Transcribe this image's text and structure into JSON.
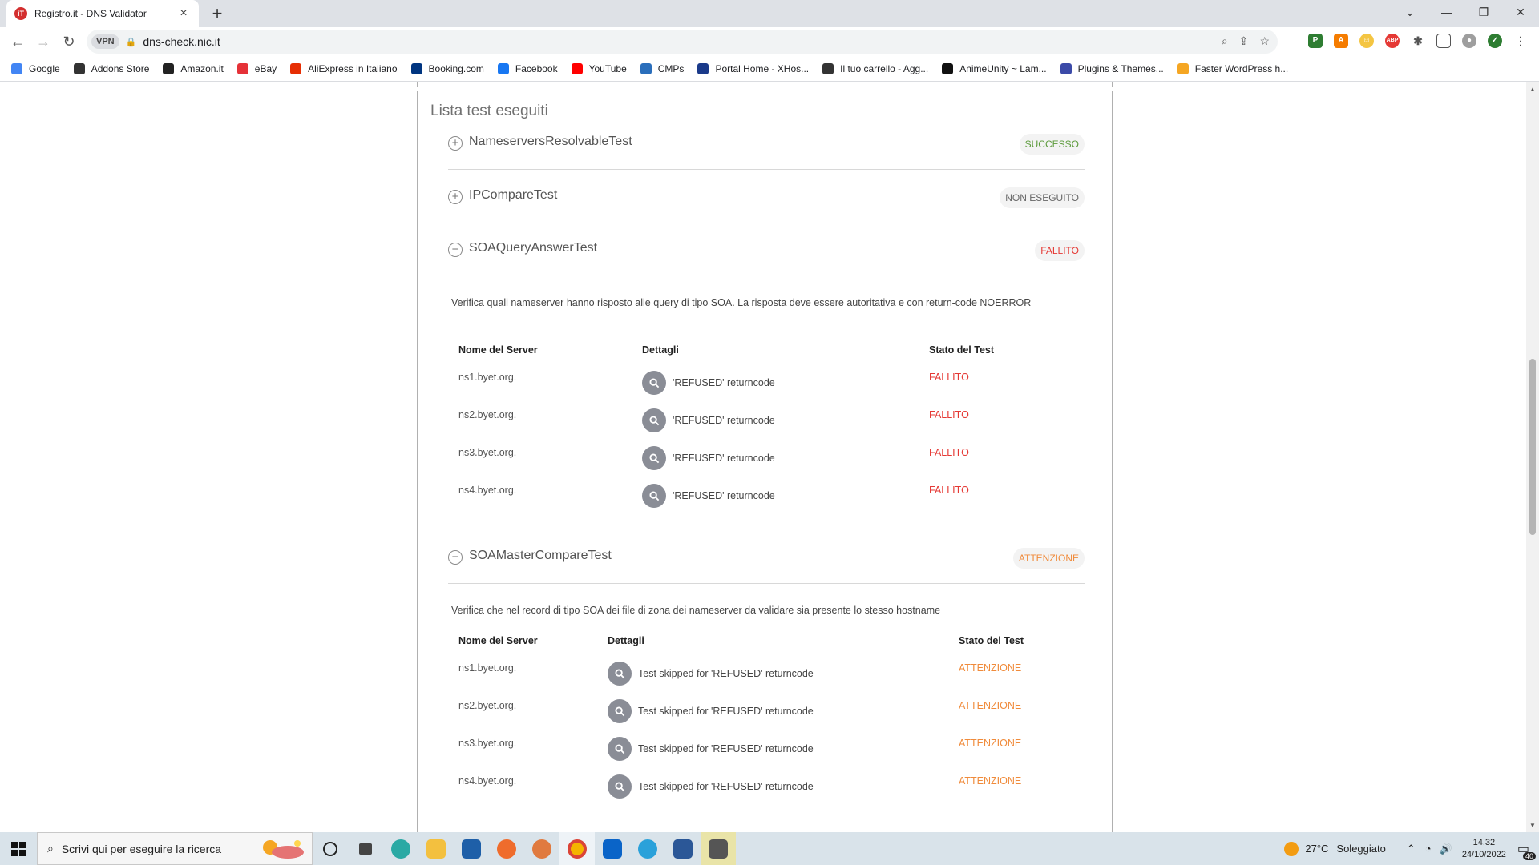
{
  "browser": {
    "tab_title": "Registro.it - DNS Validator",
    "favicon_text": "iT",
    "close_glyph": "×",
    "new_tab_glyph": "+",
    "url": "dns-check.nic.it",
    "vpn_label": "VPN"
  },
  "bookmarks": [
    {
      "label": "Google",
      "icon": "google-icon",
      "color": "#4285f4"
    },
    {
      "label": "Addons Store",
      "icon": "addons-store-icon",
      "color": "#333333"
    },
    {
      "label": "Amazon.it",
      "icon": "amazon-icon",
      "color": "#222222"
    },
    {
      "label": "eBay",
      "icon": "ebay-icon",
      "color": "#e53238"
    },
    {
      "label": "AliExpress in Italiano",
      "icon": "aliexpress-icon",
      "color": "#e62e04"
    },
    {
      "label": "Booking.com",
      "icon": "booking-icon",
      "color": "#003580"
    },
    {
      "label": "Facebook",
      "icon": "facebook-icon",
      "color": "#1877f2"
    },
    {
      "label": "YouTube",
      "icon": "youtube-icon",
      "color": "#ff0000"
    },
    {
      "label": "CMPs",
      "icon": "cmps-icon",
      "color": "#2a6ebb"
    },
    {
      "label": "Portal Home - XHos...",
      "icon": "xhost-icon",
      "color": "#1a3a8a"
    },
    {
      "label": "Il tuo carrello - Agg...",
      "icon": "brackets-icon",
      "color": "#333333"
    },
    {
      "label": "AnimeUnity ~ Lam...",
      "icon": "animeunity-icon",
      "color": "#111111"
    },
    {
      "label": "Plugins & Themes...",
      "icon": "plugins-icon",
      "color": "#3b4aa8"
    },
    {
      "label": "Faster WordPress h...",
      "icon": "lightning-icon",
      "color": "#f5a623"
    }
  ],
  "section_title": "Lista test eseguiti",
  "tests": [
    {
      "name": "NameserversResolvableTest",
      "status": "SUCCESSO",
      "expand": "+"
    },
    {
      "name": "IPCompareTest",
      "status": "NON ESEGUITO",
      "expand": "+"
    },
    {
      "name": "SOAQueryAnswerTest",
      "status": "FALLITO",
      "expand": "−"
    },
    {
      "name": "SOAMasterCompareTest",
      "status": "ATTENZIONE",
      "expand": "−"
    }
  ],
  "soa_query": {
    "description": "Verifica quali nameserver hanno risposto alle query di tipo SOA. La risposta deve essere autoritativa e con return-code NOERROR",
    "headers": {
      "server": "Nome del Server",
      "details": "Dettagli",
      "status": "Stato del Test"
    },
    "rows": [
      {
        "server": "ns1.byet.org.",
        "details": "'REFUSED' returncode",
        "status": "FALLITO"
      },
      {
        "server": "ns2.byet.org.",
        "details": "'REFUSED' returncode",
        "status": "FALLITO"
      },
      {
        "server": "ns3.byet.org.",
        "details": "'REFUSED' returncode",
        "status": "FALLITO"
      },
      {
        "server": "ns4.byet.org.",
        "details": "'REFUSED' returncode",
        "status": "FALLITO"
      }
    ]
  },
  "soa_master": {
    "description": "Verifica che nel record di tipo SOA dei file di zona dei nameserver da validare sia presente lo stesso hostname",
    "headers": {
      "server": "Nome del Server",
      "details": "Dettagli",
      "status": "Stato del Test"
    },
    "rows": [
      {
        "server": "ns1.byet.org.",
        "details": "Test skipped for 'REFUSED' returncode",
        "status": "ATTENZIONE"
      },
      {
        "server": "ns2.byet.org.",
        "details": "Test skipped for 'REFUSED' returncode",
        "status": "ATTENZIONE"
      },
      {
        "server": "ns3.byet.org.",
        "details": "Test skipped for 'REFUSED' returncode",
        "status": "ATTENZIONE"
      },
      {
        "server": "ns4.byet.org.",
        "details": "Test skipped for 'REFUSED' returncode",
        "status": "ATTENZIONE"
      }
    ]
  },
  "colors": {
    "success": "#5b9a3a",
    "failed": "#e53935",
    "warning": "#f08b3b",
    "neutral": "#666666"
  },
  "taskbar": {
    "search_placeholder": "Scrivi qui per eseguire la ricerca",
    "weather_temp": "27°C",
    "weather_desc": "Soleggiato",
    "time": "14.32",
    "date": "24/10/2022",
    "notification_count": "40"
  }
}
